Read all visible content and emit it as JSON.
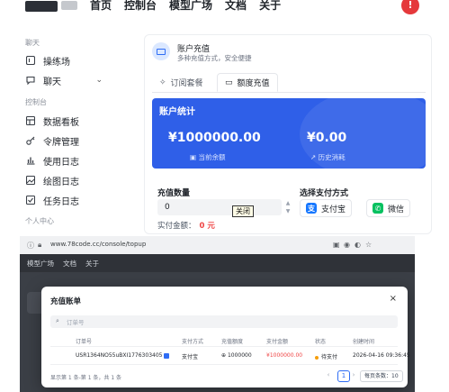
{
  "top": {
    "nav": [
      "首页",
      "控制台",
      "模型广场",
      "文档",
      "关于"
    ],
    "alert_badge": "!",
    "sidebar": {
      "group_chat": "聊天",
      "chat_items": [
        {
          "label": "操练场",
          "icon": "grid-icon"
        },
        {
          "label": "聊天",
          "icon": "chat-icon",
          "chevron": "⌄"
        }
      ],
      "group_console": "控制台",
      "console_items": [
        {
          "label": "数据看板",
          "icon": "dashboard-icon"
        },
        {
          "label": "令牌管理",
          "icon": "key-icon"
        },
        {
          "label": "使用日志",
          "icon": "chart-icon"
        },
        {
          "label": "绘图日志",
          "icon": "image-icon"
        },
        {
          "label": "任务日志",
          "icon": "check-icon"
        }
      ],
      "group_personal": "个人中心"
    },
    "card": {
      "title": "账户充值",
      "subtitle": "多种充值方式，安全便捷",
      "tabs": [
        {
          "label": "订阅套餐",
          "icon": "sparkle-icon",
          "active": false
        },
        {
          "label": "额度充值",
          "icon": "card-icon",
          "active": true
        }
      ],
      "stats": {
        "title": "账户统计",
        "balance_value": "¥1000000.00",
        "balance_label": "当前余额",
        "spent_value": "¥0.00",
        "spent_label": "历史消耗",
        "panel_color": "#2f5fe8"
      },
      "amount_label": "充值数量",
      "amount_value": "0",
      "tooltip": "关闭",
      "actual_label": "实付金额：",
      "actual_value": "0 元",
      "pay_label": "选择支付方式",
      "pay_methods": [
        {
          "label": "支付宝",
          "icon": "alipay-icon",
          "color": "#1677ff"
        },
        {
          "label": "微信",
          "icon": "wechat-icon",
          "color": "#07c160"
        }
      ]
    }
  },
  "bottom": {
    "url": "www.78code.cc/console/topup",
    "nav": [
      "模型广场",
      "文档",
      "关于"
    ],
    "modal": {
      "title": "充值账单",
      "close": "×",
      "search_placeholder": "订单号",
      "columns": [
        "订单号",
        "支付方式",
        "充值额度",
        "支付金额",
        "状态",
        "创建时间"
      ],
      "row": {
        "order_no": "USR1364NO55uBXI1776303405",
        "method": "支付宝",
        "quota": "1000000",
        "amount": "¥1000000.00",
        "status": "待支付",
        "created": "2026-04-16 09:36:45"
      },
      "pager_text": "显示第 1 条-第 1 条，共 1 条",
      "page": "1",
      "page_size": "每页条数：10"
    }
  }
}
